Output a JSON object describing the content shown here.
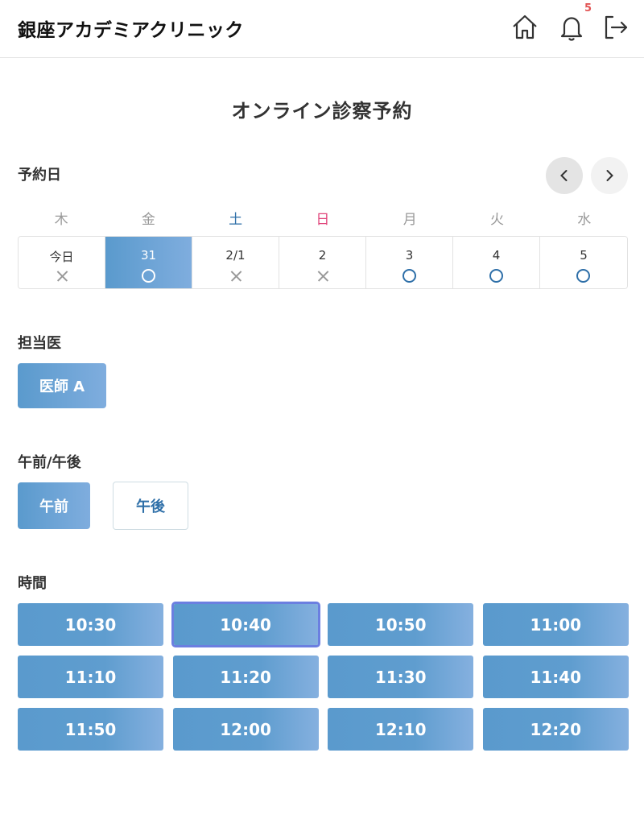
{
  "header": {
    "brand": "銀座アカデミアクリニック",
    "notification_count": "5",
    "icons": [
      "home-icon",
      "bell-icon",
      "logout-icon"
    ]
  },
  "page_title": "オンライン診察予約",
  "date_section": {
    "label": "予約日",
    "weekdays": [
      "木",
      "金",
      "土",
      "日",
      "月",
      "火",
      "水"
    ],
    "days": [
      {
        "label": "今日",
        "available": false
      },
      {
        "label": "31",
        "available": true,
        "selected": true
      },
      {
        "label": "2/1",
        "available": false
      },
      {
        "label": "2",
        "available": false
      },
      {
        "label": "3",
        "available": true
      },
      {
        "label": "4",
        "available": true
      },
      {
        "label": "5",
        "available": true
      }
    ]
  },
  "doctor_section": {
    "label": "担当医",
    "doctor": "医師 A"
  },
  "period_section": {
    "label": "午前/午後",
    "am": "午前",
    "pm": "午後",
    "selected": "午前"
  },
  "time_section": {
    "label": "時間",
    "slots": [
      "10:30",
      "10:40",
      "10:50",
      "11:00",
      "11:10",
      "11:20",
      "11:30",
      "11:40",
      "11:50",
      "12:00",
      "12:10",
      "12:20"
    ],
    "selected": "10:40"
  },
  "colors": {
    "accent": "#5a9acd",
    "accent_light": "#7fadde",
    "saturday": "#2e6fa8",
    "sunday": "#e0457b",
    "badge": "#e25555",
    "selected_outline": "#6b7fe0"
  }
}
